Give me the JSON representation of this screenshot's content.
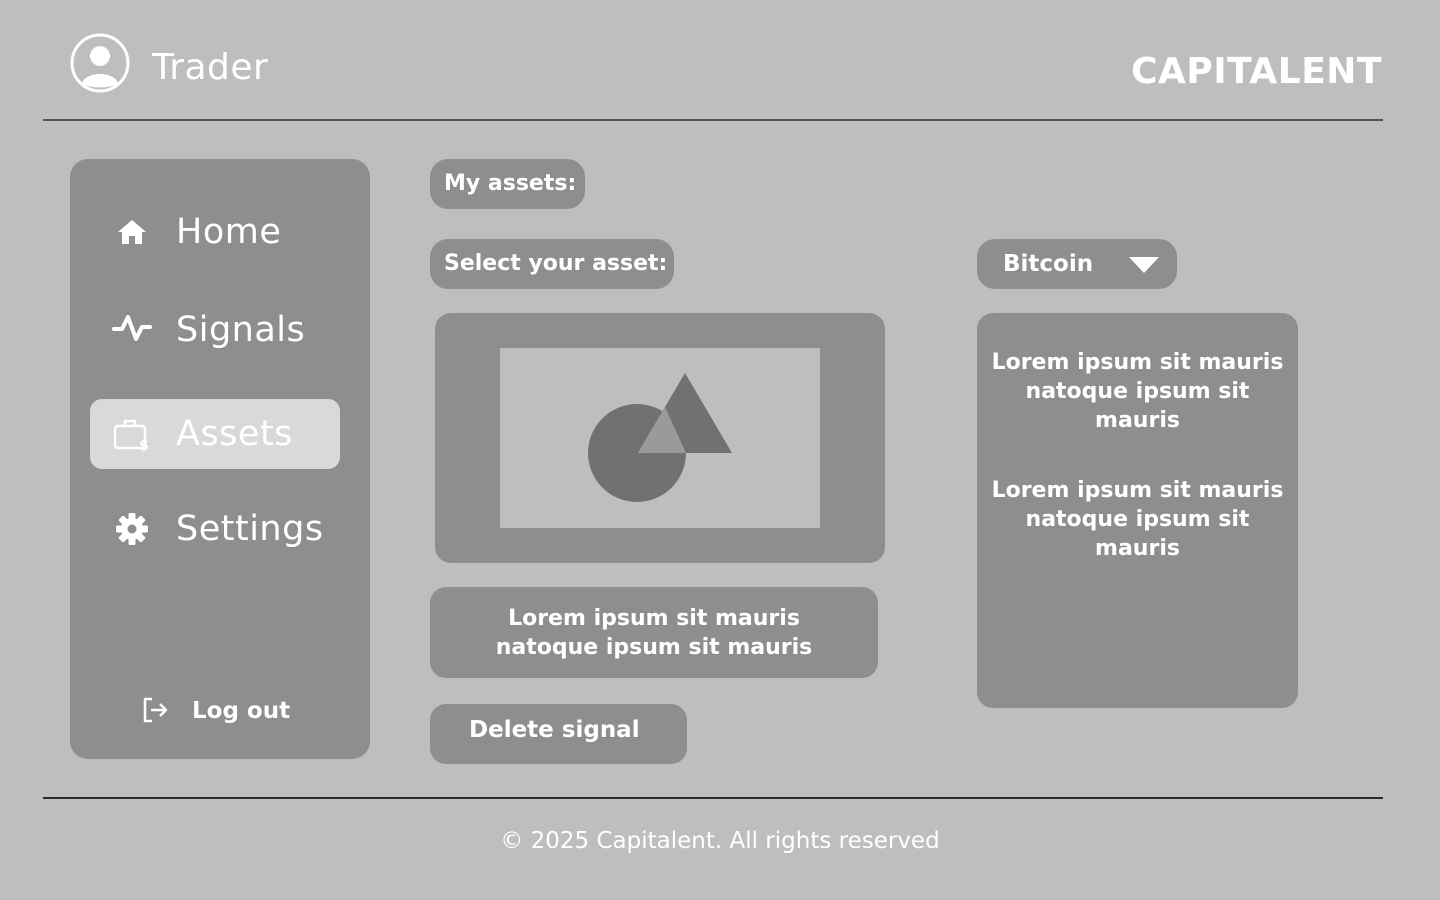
{
  "header": {
    "role_title": "Trader",
    "brand": "CAPITALENT",
    "avatar_icon": "user-circle-icon"
  },
  "sidebar": {
    "items": [
      {
        "label": "Home",
        "icon": "home-icon",
        "active": false
      },
      {
        "label": "Signals",
        "icon": "activity-icon",
        "active": false
      },
      {
        "label": "Assets",
        "icon": "briefcase-dollar-icon",
        "active": true
      },
      {
        "label": "Settings",
        "icon": "gear-icon",
        "active": false
      }
    ],
    "logout_label": "Log out",
    "logout_icon": "logout-icon"
  },
  "main": {
    "my_assets_label": "My assets:",
    "select_asset_label": "Select your asset:",
    "asset_dropdown": {
      "selected": "Bitcoin",
      "icon": "caret-down-icon"
    },
    "image_icon": "image-placeholder-icon",
    "description": "Lorem ipsum sit mauris natoque ipsum sit mauris",
    "delete_button_label": "Delete signal",
    "info_panel": {
      "paragraphs": [
        "Lorem ipsum sit mauris natoque ipsum sit mauris",
        "Lorem ipsum sit mauris natoque ipsum sit mauris"
      ]
    }
  },
  "footer": {
    "text": "© 2025 Capitalent. All rights reserved"
  },
  "colors": {
    "background": "#bebebe",
    "panel": "#8e8e8e",
    "active_item": "#d9d9d9",
    "text": "#ffffff",
    "shape": "#717171"
  }
}
